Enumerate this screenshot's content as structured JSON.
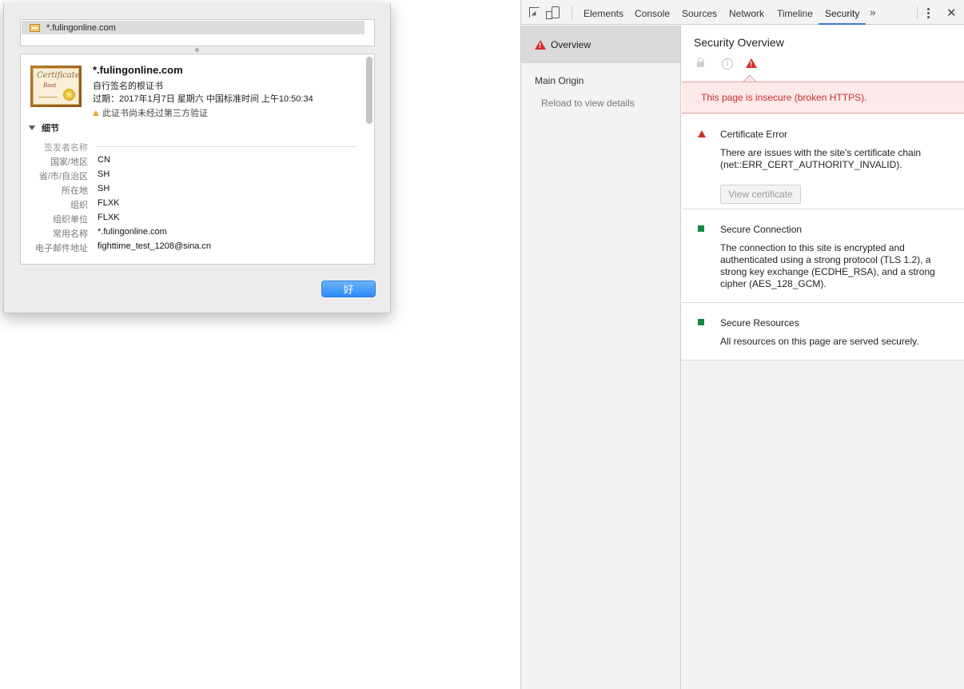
{
  "dialog": {
    "cert_list_item": "*.fulingonline.com",
    "cert": {
      "image_text": "Certificate",
      "image_subtext": "Root",
      "name": "*.fulingonline.com",
      "type": "自行签名的根证书",
      "expires": "过期：2017年1月7日 星期六 中国标准时间 上午10:50:34",
      "warning": "此证书尚未经过第三方验证"
    },
    "details_label": "细节",
    "section_label": "签发者名称",
    "fields": [
      {
        "k": "国家/地区",
        "v": "CN"
      },
      {
        "k": "省/市/自治区",
        "v": "SH"
      },
      {
        "k": "所在地",
        "v": "SH"
      },
      {
        "k": "组织",
        "v": "FLXK"
      },
      {
        "k": "组织单位",
        "v": "FLXK"
      },
      {
        "k": "常用名称",
        "v": "*.fulingonline.com"
      },
      {
        "k": "电子邮件地址",
        "v": "fighttime_test_1208@sina.cn"
      }
    ],
    "ok_label": "好"
  },
  "devtools": {
    "tabs": [
      "Elements",
      "Console",
      "Sources",
      "Network",
      "Timeline",
      "Security"
    ],
    "active_tab": "Security",
    "more_tabs": "»",
    "close": "✕",
    "sidebar": {
      "overview": "Overview",
      "main_origin": "Main Origin",
      "reload": "Reload to view details"
    },
    "main": {
      "title": "Security Overview",
      "info_glyph": "i",
      "banner": "This page is insecure (broken HTTPS).",
      "cards": [
        {
          "title": "Certificate Error",
          "desc": "There are issues with the site's certificate chain (net::ERR_CERT_AUTHORITY_INVALID).",
          "button": "View certificate",
          "status_color": "#d0302a"
        },
        {
          "title": "Secure Connection",
          "desc": "The connection to this site is encrypted and authenticated using a strong protocol (TLS 1.2), a strong key exchange (ECDHE_RSA), and a strong cipher (AES_128_GCM).",
          "status_color": "#0f8a3f"
        },
        {
          "title": "Secure Resources",
          "desc": "All resources on this page are served securely.",
          "status_color": "#0f8a3f"
        }
      ]
    }
  },
  "colors": {
    "accent": "#3879d9",
    "error": "#d0302a",
    "secure": "#0f8a3f",
    "banner_bg": "#fde9e9"
  }
}
